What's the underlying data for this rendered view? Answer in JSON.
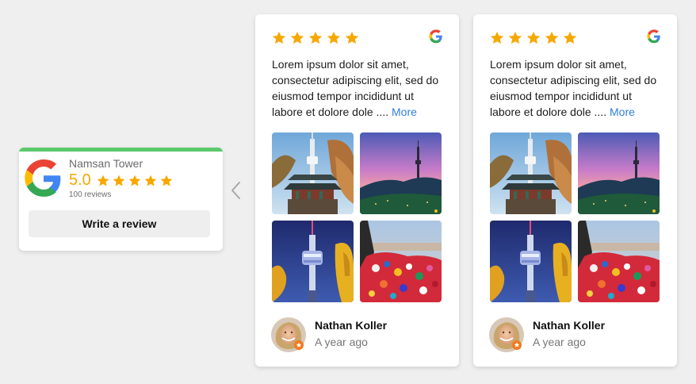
{
  "summary": {
    "place_name": "Namsan Tower",
    "rating": "5.0",
    "stars": 5,
    "review_count": "100 reviews",
    "write_review_label": "Write a review",
    "accent_color": "#5ac96a",
    "star_color": "#f6a800",
    "logo_icon": "google-icon"
  },
  "navigation": {
    "prev_icon": "chevron-left-icon"
  },
  "reviews": [
    {
      "stars": 5,
      "source_icon": "google-icon",
      "text": "Lorem ipsum dolor sit amet, consectetur adipiscing elit, sed do eiusmod tempor incididunt ut labore et dolore dole .... ",
      "more_label": "More",
      "photos": [
        "namsan-tower-pagoda",
        "namsan-tower-sunset",
        "namsan-tower-night",
        "love-locks"
      ],
      "author": "Nathan Koller",
      "time": "A year ago"
    },
    {
      "stars": 5,
      "source_icon": "google-icon",
      "text": "Lorem ipsum dolor sit amet, consectetur adipiscing elit, sed do eiusmod tempor incididunt ut labore et dolore dole .... ",
      "more_label": "More",
      "photos": [
        "namsan-tower-pagoda",
        "namsan-tower-sunset",
        "namsan-tower-night",
        "love-locks"
      ],
      "author": "Nathan Koller",
      "time": "A year ago"
    }
  ]
}
